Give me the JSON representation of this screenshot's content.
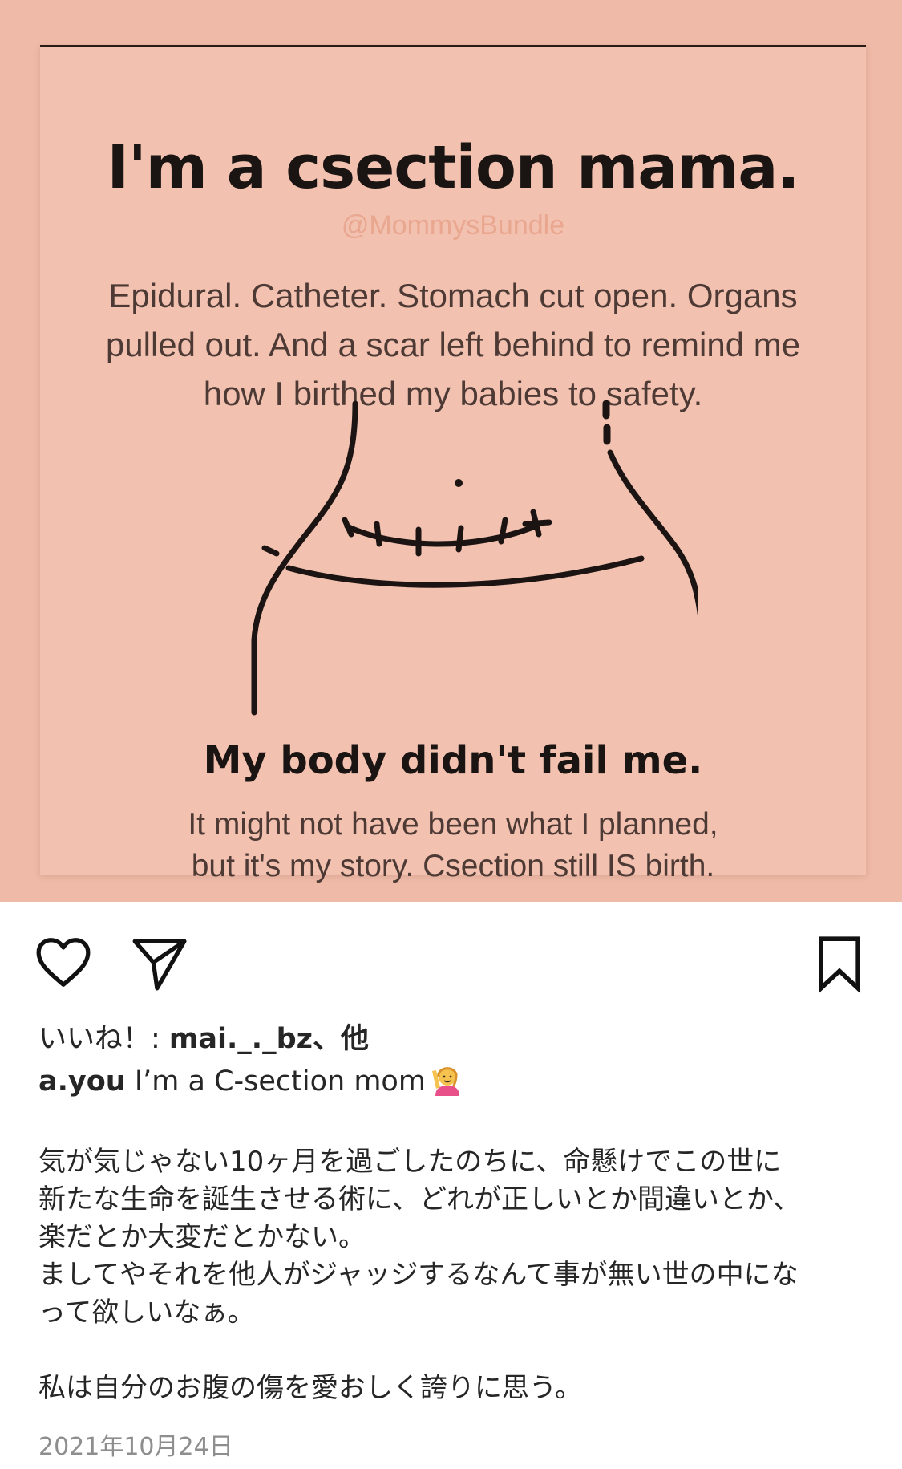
{
  "post_image": {
    "title": "I'm a csection mama.",
    "watermark": "@MommysBundle",
    "body": "Epidural. Catheter. Stomach cut open. Organs pulled out. And a scar left behind to remind me how I birthed my babies to safety.",
    "subtitle": "My body didn't fail me.",
    "footer_line1": "It might not have been what I planned,",
    "footer_line2": "but it's my story. Csection still IS birth.",
    "background_color": "#efbba8",
    "card_color": "#f2c1b0"
  },
  "actions": {
    "like_icon": "heart-icon",
    "share_icon": "paper-plane-icon",
    "save_icon": "bookmark-icon"
  },
  "likes": {
    "prefix": "いいね！: ",
    "user": "mai._._bz",
    "suffix": "、他"
  },
  "caption": {
    "username": "a.you",
    "text": " I’m a C-section mom",
    "emoji": "person-raising-hand-emoji",
    "lines": [
      "気が気じゃない10ヶ月を過ごしたのちに、命懸けでこの世に",
      "新たな生命を誕生させる術に、どれが正しいとか間違いとか、",
      "楽だとか大変だとかない。",
      "ましてやそれを他人がジャッジするなんて事が無い世の中にな",
      "って欲しいなぁ。",
      "",
      "私は自分のお腹の傷を愛おしく誇りに思う。"
    ]
  },
  "timestamp": "2021年10月24日"
}
